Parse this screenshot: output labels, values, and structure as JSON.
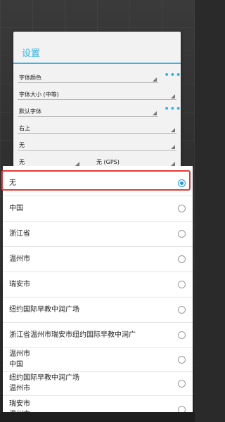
{
  "dialog": {
    "title": "设置",
    "rows": [
      {
        "label": "字体颜色",
        "has_more": true
      },
      {
        "label": "字体大小 (中等)",
        "has_more": false
      },
      {
        "label": "默认字体",
        "has_more": true
      },
      {
        "label": "右上",
        "has_more": false
      },
      {
        "label": "无",
        "has_more": false
      }
    ],
    "last_row": {
      "left": "无",
      "right": "无 (GPS)"
    }
  },
  "picker": {
    "selected_index": 0,
    "options": [
      "无",
      "中国",
      "浙江省",
      "温州市",
      "瑞安市",
      "纽约国际早教中润广场",
      "浙江省温州市瑞安市纽约国际早教中润广",
      "温州市\n中国",
      "纽约国际早教中润广场\n温州市",
      "瑞安市\n温州市"
    ]
  },
  "colors": {
    "accent": "#33b5e5",
    "radio_selected": "#2196f3",
    "highlight_border": "#e53935"
  }
}
